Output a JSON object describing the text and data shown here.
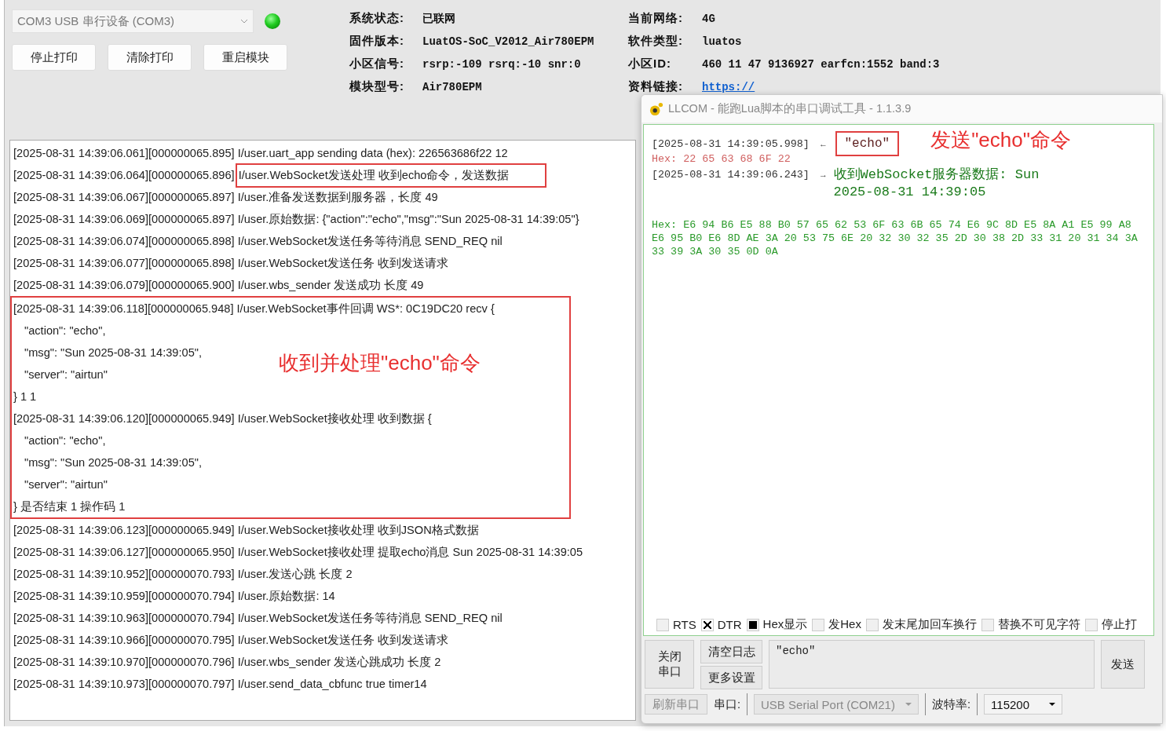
{
  "device": {
    "port": "COM3 USB 串行设备 (COM3)",
    "connected": true,
    "buttons": [
      "停止打印",
      "清除打印",
      "重启模块"
    ]
  },
  "info": [
    {
      "label": "系统状态:",
      "value": "已联网",
      "kind": "plain"
    },
    {
      "label": "当前网络:",
      "value": "4G",
      "kind": "plain"
    },
    {
      "label": "固件版本:",
      "value": "LuatOS-SoC_V2012_Air780EPM",
      "kind": "plain"
    },
    {
      "label": "软件类型:",
      "value": "luatos",
      "kind": "plain"
    },
    {
      "label": "小区信号:",
      "value": "rsrp:-109 rsrq:-10 snr:0",
      "kind": "plain"
    },
    {
      "label": "小区ID:",
      "value": "460 11 47 9136927 earfcn:1552 band:3",
      "kind": "plain"
    },
    {
      "label": "模块型号:",
      "value": "Air780EPM",
      "kind": "plain"
    },
    {
      "label": "资料链接:",
      "value": "https://",
      "kind": "link"
    }
  ],
  "log": [
    {
      "kind": "line",
      "time": "[2025-08-31 14:39:06.061][000000065.895]",
      "message": "I/user.uart_app sending data (hex): 226563686f22 12",
      "marked": false
    },
    {
      "kind": "line",
      "time": "[2025-08-31 14:39:06.064][000000065.896]",
      "message": "I/user.WebSocket发送处理 收到echo命令，发送数据",
      "marked": true
    },
    {
      "kind": "line",
      "time": "[2025-08-31 14:39:06.067][000000065.897]",
      "message": "I/user.准备发送数据到服务器，长度 49",
      "marked": false
    },
    {
      "kind": "line",
      "time": "[2025-08-31 14:39:06.069][000000065.897]",
      "message": "I/user.原始数据: {\"action\":\"echo\",\"msg\":\"Sun 2025-08-31 14:39:05\"}",
      "marked": false
    },
    {
      "kind": "line",
      "time": "[2025-08-31 14:39:06.074][000000065.898]",
      "message": "I/user.WebSocket发送任务等待消息 SEND_REQ nil",
      "marked": false
    },
    {
      "kind": "line",
      "time": "[2025-08-31 14:39:06.077][000000065.898]",
      "message": "I/user.WebSocket发送任务 收到发送请求",
      "marked": false
    },
    {
      "kind": "line",
      "time": "[2025-08-31 14:39:06.079][000000065.900]",
      "message": "I/user.wbs_sender 发送成功 长度 49",
      "marked": false
    },
    {
      "kind": "group",
      "note": "收到并处理\"echo\"命令",
      "lines": [
        {
          "kind": "line",
          "time": "[2025-08-31 14:39:06.118][000000065.948]",
          "message": "I/user.WebSocket事件回调 WS*: 0C19DC20 recv {",
          "marked": false
        },
        {
          "kind": "cont",
          "text": "\"action\": \"echo\","
        },
        {
          "kind": "cont",
          "text": "\"msg\": \"Sun 2025-08-31 14:39:05\","
        },
        {
          "kind": "cont",
          "text": "\"server\": \"airtun\""
        },
        {
          "kind": "close",
          "text": "} 1 1"
        },
        {
          "kind": "line",
          "time": "[2025-08-31 14:39:06.120][000000065.949]",
          "message": "I/user.WebSocket接收处理 收到数据 {",
          "marked": false
        },
        {
          "kind": "cont",
          "text": "\"action\": \"echo\","
        },
        {
          "kind": "cont",
          "text": "\"msg\": \"Sun 2025-08-31 14:39:05\","
        },
        {
          "kind": "cont",
          "text": "\"server\": \"airtun\""
        },
        {
          "kind": "close",
          "text": "} 是否结束 1 操作码 1"
        }
      ]
    },
    {
      "kind": "line",
      "time": "[2025-08-31 14:39:06.123][000000065.949]",
      "message": "I/user.WebSocket接收处理 收到JSON格式数据",
      "marked": false
    },
    {
      "kind": "line",
      "time": "[2025-08-31 14:39:06.127][000000065.950]",
      "message": "I/user.WebSocket接收处理 提取echo消息 Sun 2025-08-31 14:39:05",
      "marked": false
    },
    {
      "kind": "line",
      "time": "[2025-08-31 14:39:10.952][000000070.793]",
      "message": "I/user.发送心跳 长度 2",
      "marked": false
    },
    {
      "kind": "line",
      "time": "[2025-08-31 14:39:10.959][000000070.794]",
      "message": "I/user.原始数据: 14",
      "marked": false
    },
    {
      "kind": "line",
      "time": "[2025-08-31 14:39:10.963][000000070.794]",
      "message": "I/user.WebSocket发送任务等待消息 SEND_REQ nil",
      "marked": false
    },
    {
      "kind": "line",
      "time": "[2025-08-31 14:39:10.966][000000070.795]",
      "message": "I/user.WebSocket发送任务 收到发送请求",
      "marked": false
    },
    {
      "kind": "line",
      "time": "[2025-08-31 14:39:10.970][000000070.796]",
      "message": "I/user.wbs_sender 发送心跳成功 长度 2",
      "marked": false
    },
    {
      "kind": "line",
      "time": "[2025-08-31 14:39:10.973][000000070.797]",
      "message": "I/user.send_data_cbfunc true timer14",
      "marked": false
    }
  ],
  "llcom": {
    "title": "LLCOM - 能跑Lua脚本的串口调试工具 - 1.1.3.9",
    "messages": [
      {
        "kind": "sent",
        "time": "[2025-08-31 14:39:05.998]",
        "arrow": "←",
        "text": "\"echo\"",
        "marked": true,
        "note": "发送\"echo\"命令",
        "hex": "Hex: 22 65 63 68 6F 22"
      },
      {
        "kind": "received",
        "time": "[2025-08-31 14:39:06.243]",
        "arrow": "→",
        "text": "收到WebSocket服务器数据: Sun 2025-08-31 14:39:05",
        "marked": false,
        "hex": "Hex: E6 94 B6 E5 88 B0 57 65 62 53 6F 63 6B 65 74 E6 9C 8D E5 8A A1 E5 99 A8 E6 95 B0 E6 8D AE 3A 20 53 75 6E 20 32 30 32 35 2D 30 38 2D 33 31 20 31 34 3A 33 39 3A 30 35 0D 0A"
      }
    ],
    "options": [
      {
        "label": "RTS",
        "kind": "cross",
        "checked": false
      },
      {
        "label": "DTR",
        "kind": "cross",
        "checked": true
      },
      {
        "label": "Hex显示",
        "kind": "square",
        "checked": true
      },
      {
        "label": "发Hex",
        "kind": "cross",
        "checked": false
      },
      {
        "label": "发末尾加回车换行",
        "kind": "cross",
        "checked": false
      },
      {
        "label": "替换不可见字符",
        "kind": "cross",
        "checked": false
      },
      {
        "label": "停止打",
        "kind": "cross",
        "checked": false
      }
    ],
    "close_button": "关闭串口",
    "clear_button": "清空日志",
    "more_button": "更多设置",
    "input": "\"echo\"",
    "send_button": "发送",
    "status": {
      "refresh": "刷新串口",
      "port_label": "串口:",
      "port": "USB Serial Port (COM21)",
      "baud_label": "波特率:",
      "baud": "115200"
    }
  }
}
